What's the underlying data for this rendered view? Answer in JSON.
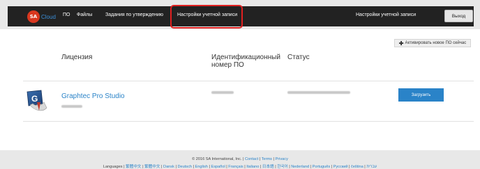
{
  "nav": {
    "logo_text": "SA",
    "cloud_label": "Cloud",
    "items": [
      "ПО",
      "Файлы",
      "Задания по утверждению",
      "Настройки учетной записи"
    ],
    "account_settings": "Настройки учетной записи",
    "logout": "Выход"
  },
  "actions": {
    "activate": "Активировать новое ПО сейчас"
  },
  "table": {
    "headers": {
      "license": "Лицензия",
      "id_line1": "Идентификационный",
      "id_line2": "номер ПО",
      "status": "Статус"
    },
    "rows": [
      {
        "name": "Graphtec Pro Studio",
        "download": "Загрузить"
      }
    ]
  },
  "footer": {
    "copyright_prefix": "© 2016 SA International, Inc. | ",
    "contact": "Contact",
    "terms": "Terms",
    "privacy": "Privacy",
    "languages_label": "Languages",
    "languages": [
      "繁體中文",
      "繁體中文",
      "Dansk",
      "Deutsch",
      "English",
      "Español",
      "Français",
      "Italiano",
      "日本語",
      "한국어",
      "Nederland",
      "Português",
      "Русский",
      "čeština",
      "עברית"
    ]
  },
  "colors": {
    "navbar": "#222222",
    "accent": "#2a83c8",
    "highlight": "#e02020"
  }
}
